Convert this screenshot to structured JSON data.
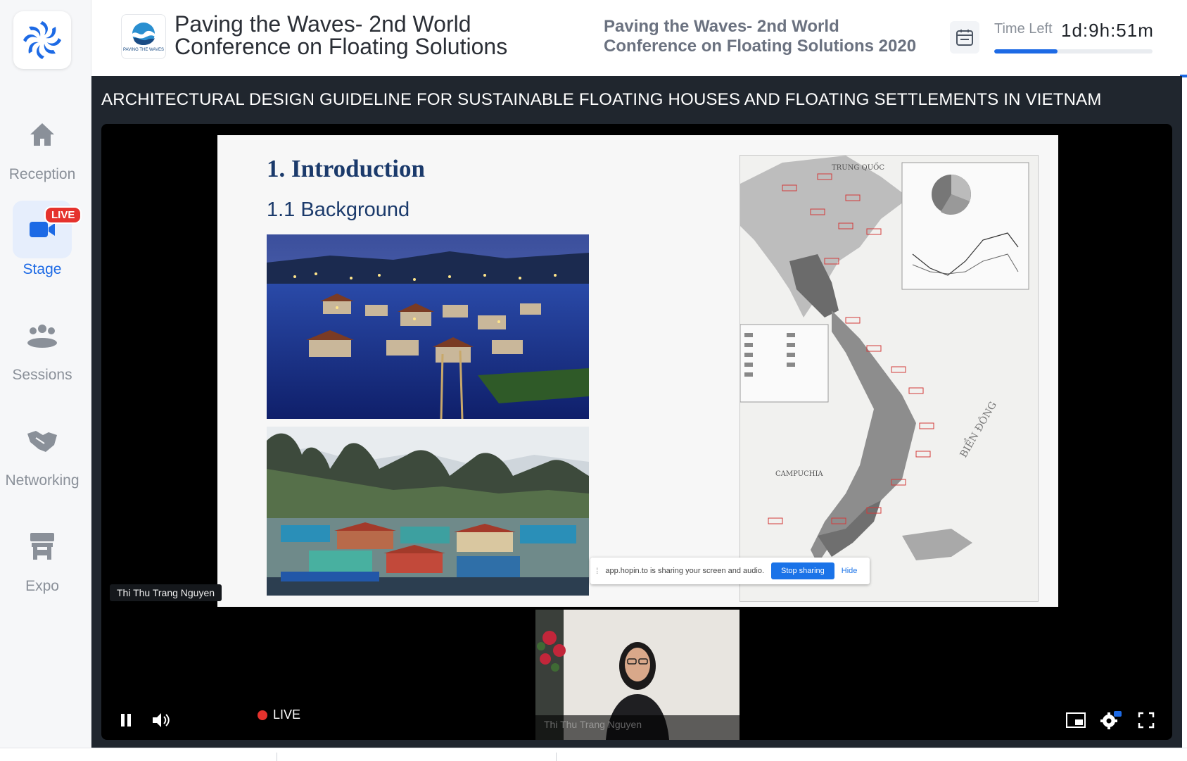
{
  "sidebar": {
    "items": [
      {
        "label": "Reception",
        "icon": "home-icon",
        "active": false
      },
      {
        "label": "Stage",
        "icon": "video-camera-icon",
        "active": true,
        "badge": "LIVE"
      },
      {
        "label": "Sessions",
        "icon": "people-icon",
        "active": false
      },
      {
        "label": "Networking",
        "icon": "handshake-icon",
        "active": false
      },
      {
        "label": "Expo",
        "icon": "booth-icon",
        "active": false
      }
    ]
  },
  "header": {
    "event_title": "Paving the Waves- 2nd World Conference on Floating Solutions",
    "event_subtitle": "Paving the Waves- 2nd World Conference on Floating Solutions 2020",
    "logo_caption": "PAVING THE WAVES",
    "time_left_label": "Time Left",
    "time_left_value": "1d:9h:51m",
    "time_progress": 0.4
  },
  "stage": {
    "session_title": "ARCHITECTURAL DESIGN GUIDELINE FOR SUSTAINABLE FLOATING HOUSES AND FLOATING SETTLEMENTS IN VIETNAM",
    "slide": {
      "heading": "1. Introduction",
      "subheading": "1.1 Background",
      "map_labels": {
        "north": "TRUNG QUỐC",
        "west": "CAMPUCHIA",
        "sea": "BIỂN ĐÔNG"
      }
    },
    "share_banner": {
      "message": "app.hopin.to is sharing your screen and audio.",
      "stop_label": "Stop sharing",
      "hide_label": "Hide"
    },
    "presenter_name": "Thi Thu Trang Nguyen",
    "webcam_name": "Thi Thu Trang Nguyen",
    "live_label": "LIVE"
  },
  "colors": {
    "accent": "#1d6ae5",
    "live": "#e5322d",
    "stage_bg": "#20262e"
  }
}
